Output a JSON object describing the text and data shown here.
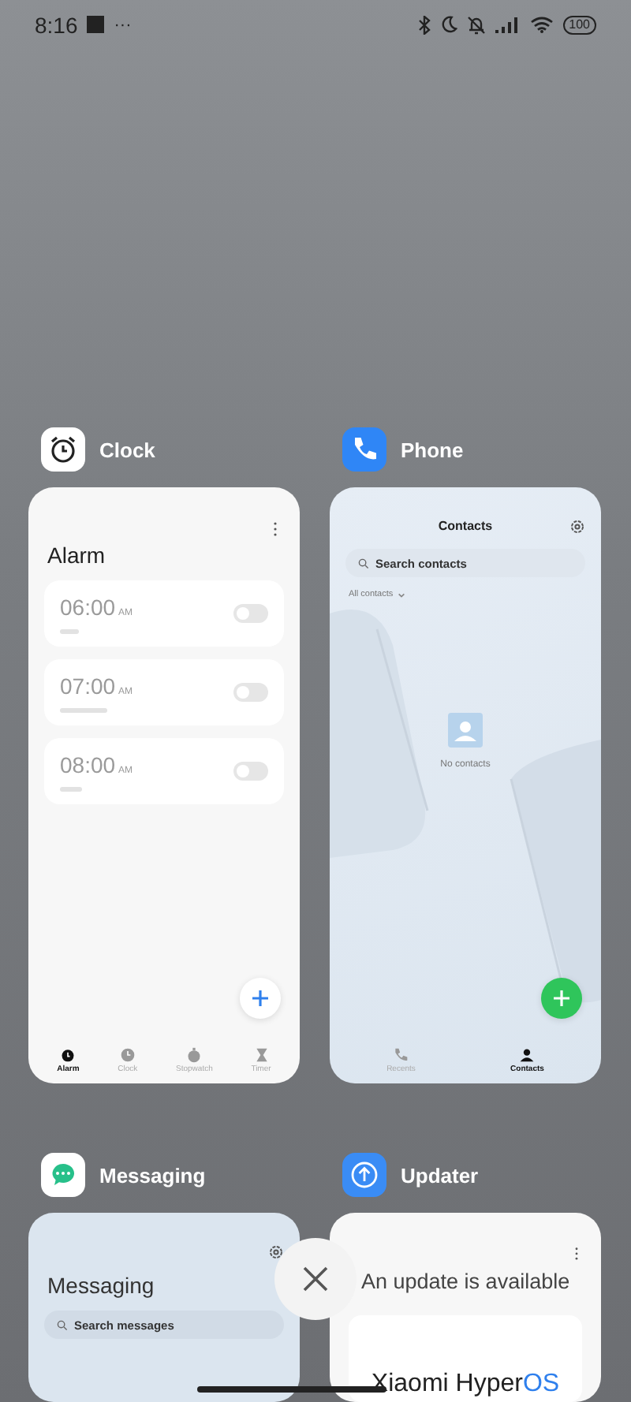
{
  "status_bar": {
    "time": "8:16",
    "more": "···",
    "battery": "100"
  },
  "apps": [
    {
      "kind": "clock",
      "name": "Clock",
      "title": "Alarm",
      "alarms": [
        {
          "time": "06:00",
          "period": "AM",
          "on": false
        },
        {
          "time": "07:00",
          "period": "AM",
          "on": false
        },
        {
          "time": "08:00",
          "period": "AM",
          "on": false
        }
      ],
      "tabs": [
        {
          "label": "Alarm",
          "selected": true
        },
        {
          "label": "Clock",
          "selected": false
        },
        {
          "label": "Stopwatch",
          "selected": false
        },
        {
          "label": "Timer",
          "selected": false
        }
      ]
    },
    {
      "kind": "phone",
      "name": "Phone",
      "title": "Contacts",
      "search": {
        "placeholder": "Search contacts"
      },
      "filter": "All contacts",
      "empty": "No contacts",
      "tabs": [
        {
          "label": "Recents",
          "selected": false
        },
        {
          "label": "Contacts",
          "selected": true
        }
      ]
    },
    {
      "kind": "messaging",
      "name": "Messaging",
      "title": "Messaging",
      "search": {
        "placeholder": "Search messages"
      }
    },
    {
      "kind": "updater",
      "name": "Updater",
      "title": "An update is available",
      "brand": "Xiaomi Hyper",
      "brand_accent": "OS"
    }
  ]
}
